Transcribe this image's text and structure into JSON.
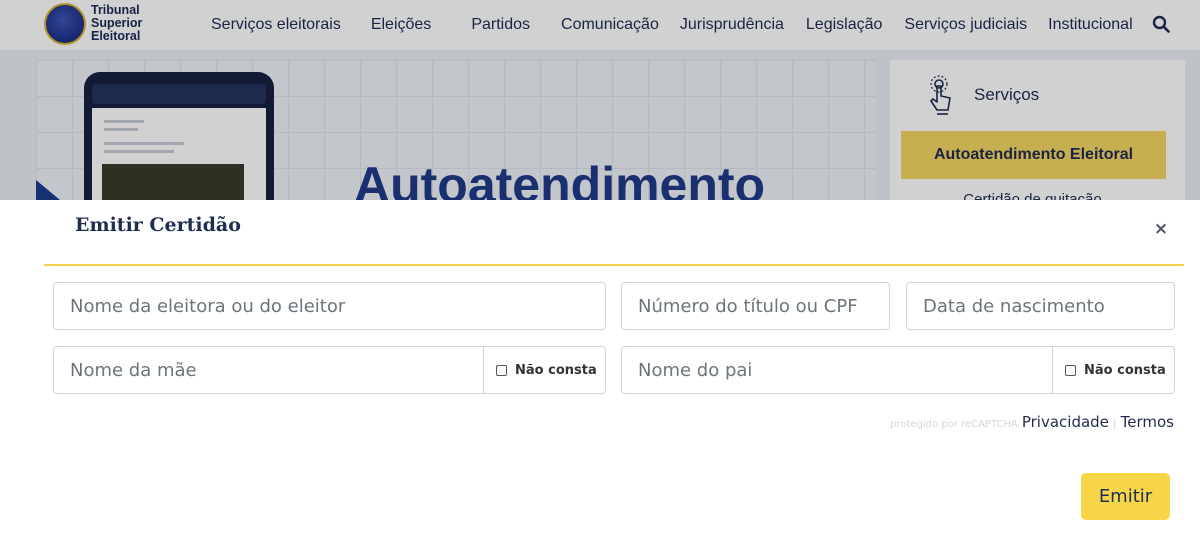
{
  "header": {
    "logo_lines": [
      "Tribunal",
      "Superior",
      "Eleitoral"
    ],
    "nav": [
      "Serviços eleitorais",
      "Eleições",
      "Partidos",
      "Comunicação",
      "Jurisprudência",
      "Legislação",
      "Serviços judiciais",
      "Institucional"
    ]
  },
  "hero": {
    "title": "Autoatendimento"
  },
  "sidebar": {
    "title": "Serviços",
    "active_item": "Autoatendimento Eleitoral",
    "next_item": "Certidão de quitação"
  },
  "modal": {
    "title": "Emitir Certidão",
    "close_label": "×",
    "fields": {
      "name_placeholder": "Nome da eleitora ou do eleitor",
      "doc_placeholder": "Número do título ou CPF",
      "birth_placeholder": "Data de nascimento",
      "mother_placeholder": "Nome da mãe",
      "father_placeholder": "Nome do pai",
      "not_listed_label": "Não consta"
    },
    "recaptcha": {
      "protected_text": "protegido por reCAPTCHA",
      "privacy_label": "Privacidade",
      "terms_label": "Termos"
    },
    "submit_label": "Emitir"
  },
  "colors": {
    "accent_yellow": "#f7d548",
    "brand_navy": "#1f2d52",
    "hero_blue": "#1f3a88"
  }
}
